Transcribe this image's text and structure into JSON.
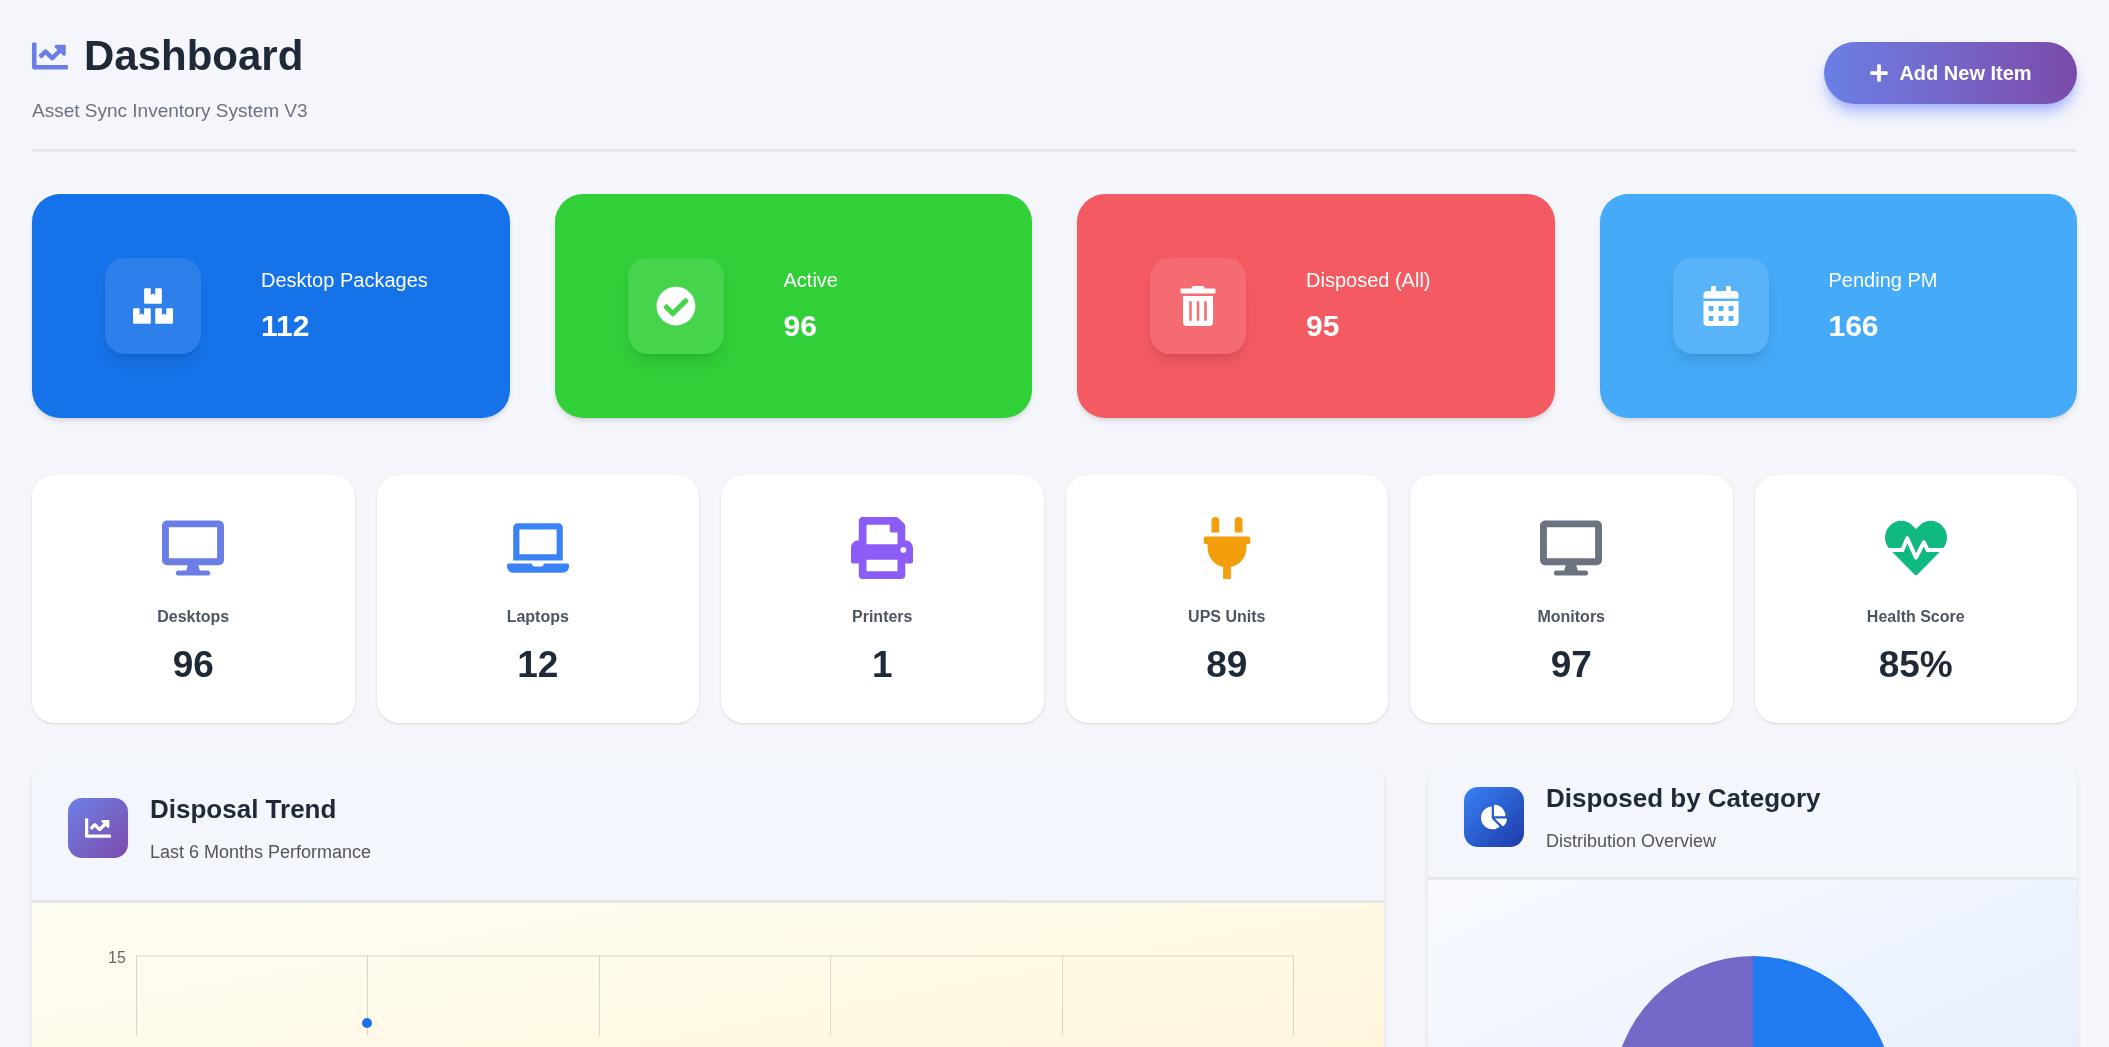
{
  "header": {
    "title": "Dashboard",
    "subtitle": "Asset Sync Inventory System V3",
    "add_button": "Add New Item"
  },
  "summary_cards": [
    {
      "kind": "packages",
      "label": "Desktop Packages",
      "value": "112",
      "color": "#1672e8"
    },
    {
      "kind": "active",
      "label": "Active",
      "value": "96",
      "color": "#31cf38"
    },
    {
      "kind": "disposed",
      "label": "Disposed (All)",
      "value": "95",
      "color": "#f45a62"
    },
    {
      "kind": "pending",
      "label": "Pending PM",
      "value": "166",
      "color": "#45aaf7"
    }
  ],
  "device_cards": [
    {
      "kind": "desktop",
      "label": "Desktops",
      "value": "96",
      "color": "#6a7fe6"
    },
    {
      "kind": "laptop",
      "label": "Laptops",
      "value": "12",
      "color": "#3b82f6"
    },
    {
      "kind": "printer",
      "label": "Printers",
      "value": "1",
      "color": "#8b5cf6"
    },
    {
      "kind": "ups",
      "label": "UPS Units",
      "value": "89",
      "color": "#f59e0b"
    },
    {
      "kind": "monitor",
      "label": "Monitors",
      "value": "97",
      "color": "#6b7280"
    },
    {
      "kind": "health",
      "label": "Health Score",
      "value": "85%",
      "color": "#10b981"
    }
  ],
  "trend_panel": {
    "title": "Disposal Trend",
    "subtitle": "Last 6 Months Performance",
    "y_tick": "15"
  },
  "category_panel": {
    "title": "Disposed by Category",
    "subtitle": "Distribution Overview"
  }
}
